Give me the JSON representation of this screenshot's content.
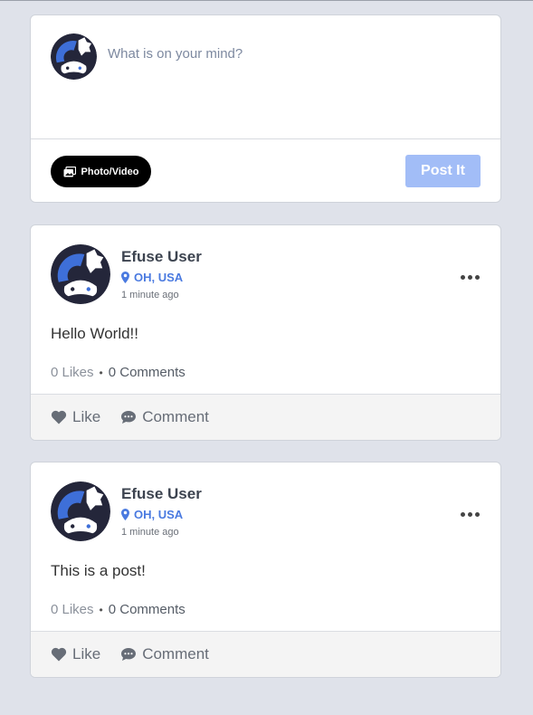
{
  "composer": {
    "placeholder": "What is on your mind?",
    "photo_video_label": "Photo/Video",
    "post_button_label": "Post It"
  },
  "posts": [
    {
      "author": "Efuse User",
      "location": "OH, USA",
      "time": "1 minute ago",
      "text": "Hello World!!",
      "likes": "0 Likes",
      "comments": "0 Comments"
    },
    {
      "author": "Efuse User",
      "location": "OH, USA",
      "time": "1 minute ago",
      "text": "This is a post!",
      "likes": "0 Likes",
      "comments": "0 Comments"
    }
  ],
  "actions": {
    "like_label": "Like",
    "comment_label": "Comment"
  },
  "icons": {
    "avatar": "gamepad-avatar-icon",
    "photo": "photo-video-icon",
    "location": "map-pin-icon",
    "more": "more-dots-icon",
    "like": "heart-icon",
    "comment": "comment-bubble-icon"
  },
  "colors": {
    "accent": "#4a7ae0",
    "post_button": "#a2bdf7",
    "background": "#dfe2ea"
  }
}
